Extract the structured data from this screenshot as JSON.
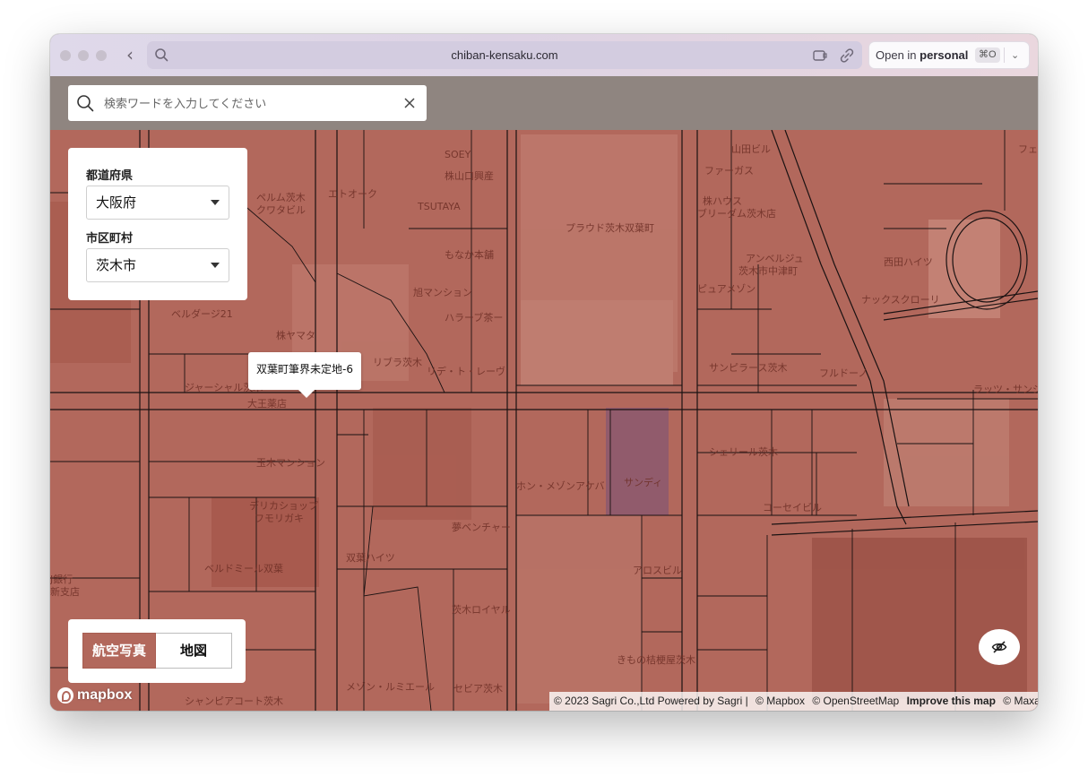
{
  "browser": {
    "url": "chiban-kensaku.com",
    "open_in_prefix": "Open in",
    "open_in_profile": "personal",
    "open_in_shortcut": "⌘O"
  },
  "search": {
    "placeholder": "検索ワードを入力してください"
  },
  "filters": {
    "prefecture_label": "都道府県",
    "prefecture_value": "大阪府",
    "city_label": "市区町村",
    "city_value": "茨木市"
  },
  "map": {
    "tooltip": "双葉町筆界未定地-6",
    "overlay_color": "#b2685c",
    "place_labels": [
      "SOEY",
      "株山口興産",
      "TSUTAYA",
      "エトオーク",
      "ペルム茨木",
      "クワタビル",
      "もなか本舗",
      "プラウド茨木双葉町",
      "旭マンション",
      "ハラーブ茶ー",
      "ベルダージ21",
      "株ヤマタ",
      "リブラ茨木",
      "リデ・ト・レーヴ",
      "ジャーシャル茨木",
      "大王薬店",
      "玉木マンション",
      "ホン・メゾンアケバ",
      "サンディ",
      "デリカショップ",
      "フモリガキ",
      "夢ベンチャー",
      "双葉ハイツ",
      "ベルドミール双葉",
      "茨木ロイヤル",
      "メゾン・ルミエール",
      "セビア茨木",
      "シャンピアコート茨木",
      "きもの桔梗屋茨木",
      "アロスビル",
      "株ハウス",
      "ブリーダム茨木店",
      "アンベルジュ",
      "茨木市中津町",
      "ピュアメゾン",
      "サンピラース茨木",
      "フルドーノ",
      "ナックスクローリ",
      "西田ハイツ",
      "ラッツ・サンジ",
      "シェリール茨木",
      "コーセイビル",
      "J銀行",
      "新支店",
      "フェ",
      "山田ビル",
      "ファーガス"
    ]
  },
  "view_toggle": {
    "aerial_label": "航空写真",
    "map_label": "地図"
  },
  "attribution": {
    "sagri": "© 2023 Sagri Co.,Ltd Powered by Sagri",
    "sep": "|",
    "mapbox": "© Mapbox",
    "osm": "© OpenStreetMap",
    "improve": "Improve this map",
    "maxar": "© Maxar"
  },
  "logo": "mapbox",
  "icons": {
    "search": "search-icon",
    "clear": "close-icon",
    "select_caret": "caret-down-icon",
    "visibility": "eye-off-icon"
  }
}
